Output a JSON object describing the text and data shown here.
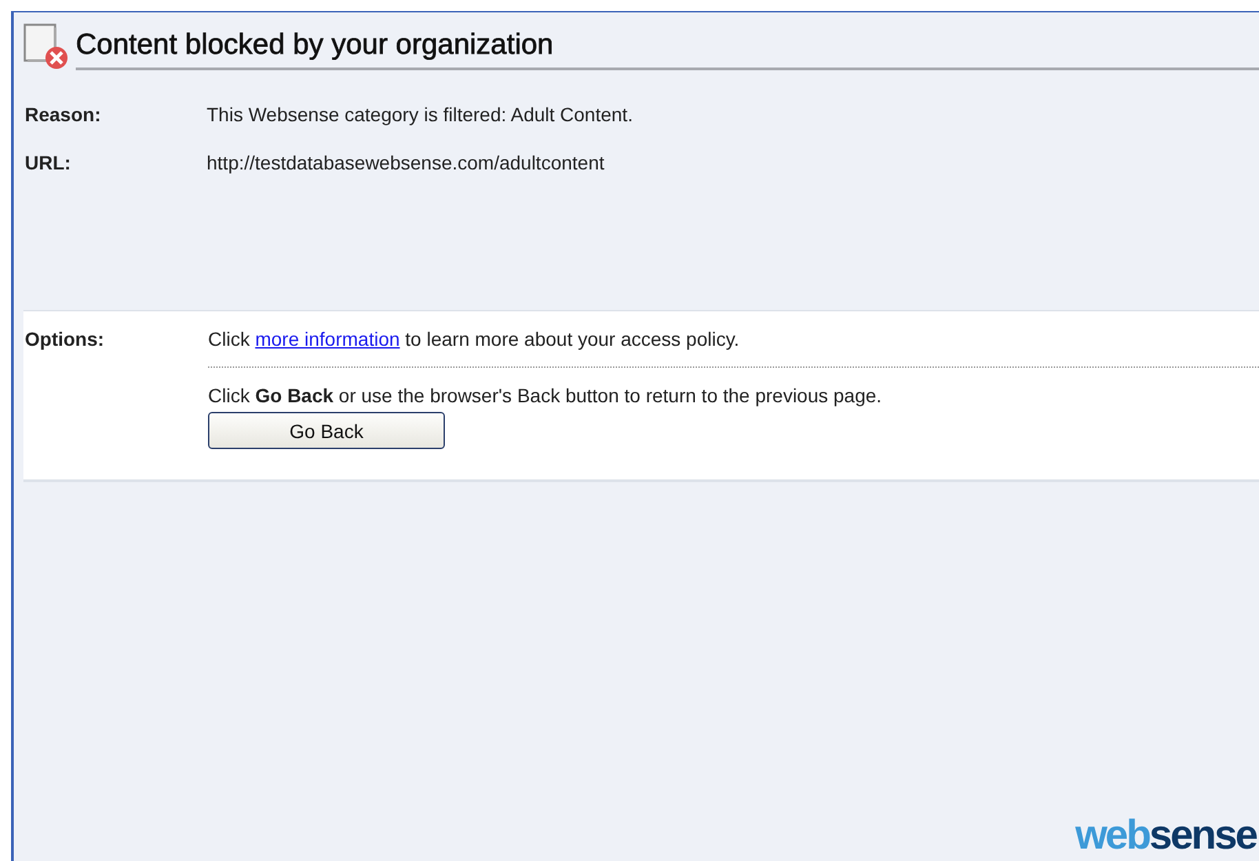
{
  "title": "Content blocked by your organization",
  "details": [
    {
      "label": "Reason:",
      "value": "This Websense category is filtered: Adult Content."
    },
    {
      "label": "URL:",
      "value": "http://testdatabasewebsense.com/adultcontent"
    }
  ],
  "options": {
    "label": "Options:",
    "info": {
      "before": "Click ",
      "link": "more information",
      "after": " to learn more about your access policy."
    },
    "back_text": "Click **Go Back** or use the browser's Back button to return to the previous page.",
    "back_button": "Go Back"
  },
  "logo": {
    "first": "web",
    "second": "sense"
  }
}
